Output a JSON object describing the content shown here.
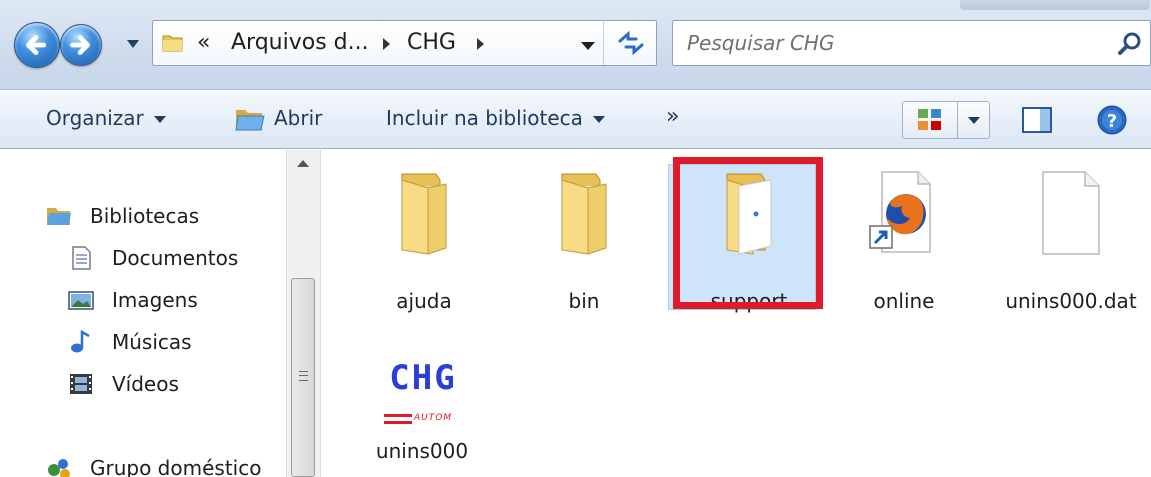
{
  "colors": {
    "highlight": "#e0192b",
    "selection": "#cde4fb",
    "command_text": "#1e3a5f",
    "chg_blue": "#2b3fd6",
    "chg_red": "#e0192b"
  },
  "address_bar": {
    "overflow_marker": "«",
    "crumbs": [
      "Arquivos d...",
      "CHG"
    ],
    "search_placeholder": "Pesquisar CHG"
  },
  "command_bar": {
    "organize": "Organizar",
    "open": "Abrir",
    "include_library": "Incluir na biblioteca",
    "more": "»"
  },
  "nav_pane": {
    "libraries": "Bibliotecas",
    "items": [
      "Documentos",
      "Imagens",
      "Músicas",
      "Vídeos"
    ],
    "homegroup": "Grupo doméstico"
  },
  "files": [
    {
      "name": "ajuda",
      "type": "folder"
    },
    {
      "name": "bin",
      "type": "folder"
    },
    {
      "name": "support",
      "type": "folder",
      "highlighted": true
    },
    {
      "name": "online",
      "type": "shortcut-firefox"
    },
    {
      "name": "unins000.dat",
      "type": "blank-file"
    },
    {
      "name": "unins000",
      "type": "chg-app"
    }
  ],
  "chg_logo": {
    "text": "CHG",
    "subtext": "AUTOM"
  }
}
